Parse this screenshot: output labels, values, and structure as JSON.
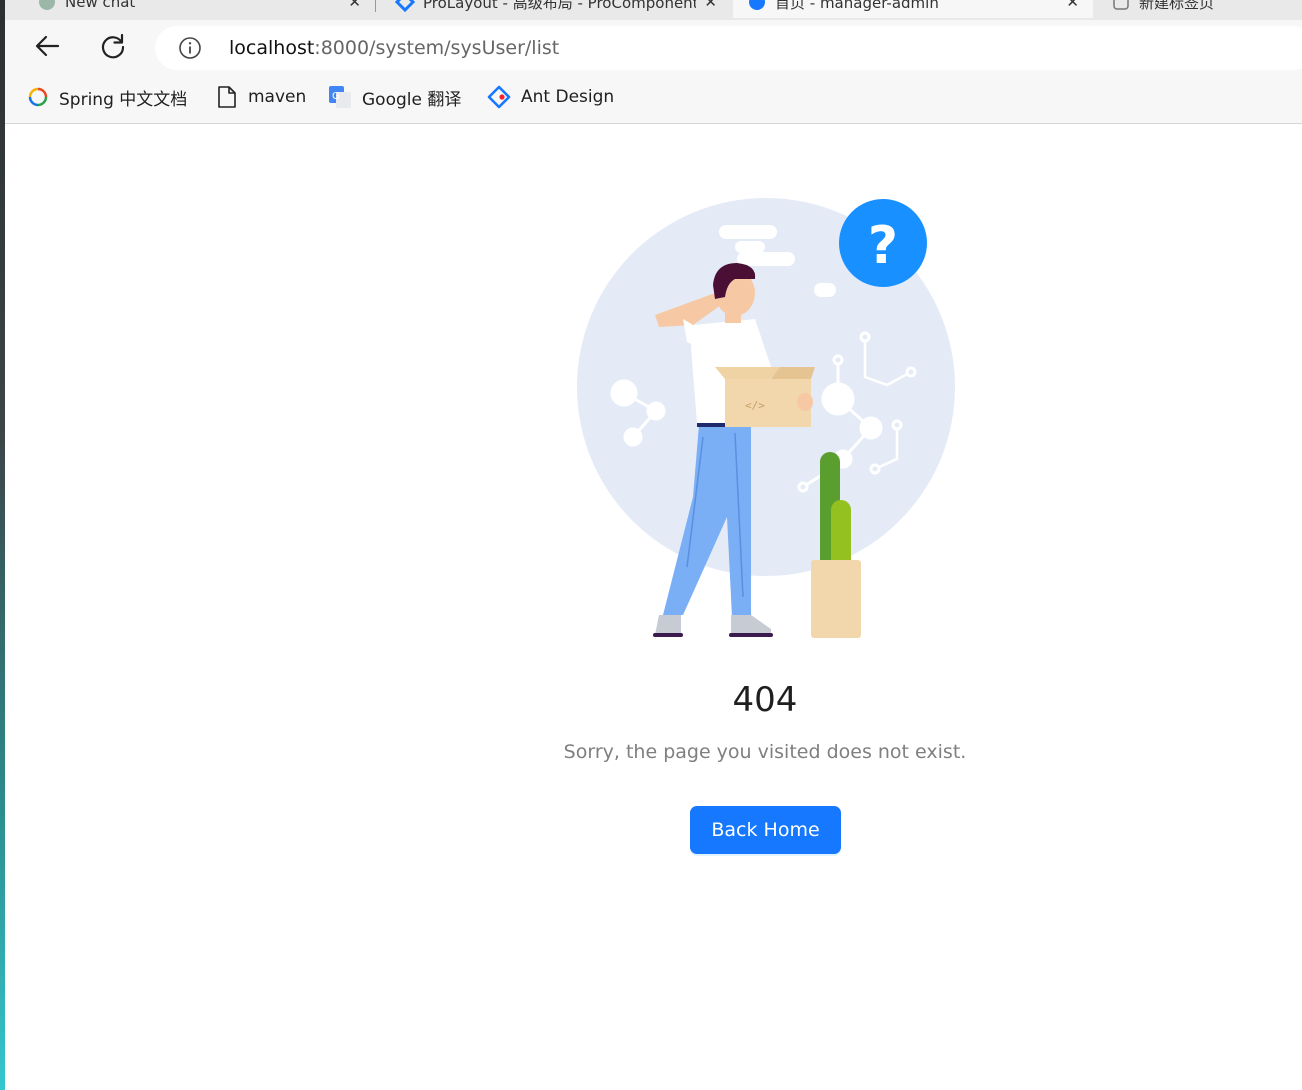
{
  "browser": {
    "tabs": [
      {
        "title": "New chat",
        "icon": "chat-app-icon",
        "active": false
      },
      {
        "title": "ProLayout - 高级布局 - ProComponents",
        "icon": "procomponents-icon",
        "active": false
      },
      {
        "title": "首页 - manager-admin",
        "icon": "site-favicon",
        "active": true
      },
      {
        "title": "新建标签页",
        "icon": "new-tab-icon",
        "active": false
      }
    ],
    "close_glyph": "✕",
    "address": {
      "host": "localhost",
      "rest": ":8000/system/sysUser/list"
    },
    "bookmarks": [
      {
        "label": "Spring 中文文档",
        "icon": "spring-icon"
      },
      {
        "label": "maven",
        "icon": "page-icon"
      },
      {
        "label": "Google 翻译",
        "icon": "google-translate-icon"
      },
      {
        "label": "Ant Design",
        "icon": "ant-design-icon"
      }
    ]
  },
  "page": {
    "status_code": "404",
    "message": "Sorry, the page you visited does not exist.",
    "button_label": "Back Home",
    "question_glyph": "?",
    "colors": {
      "primary": "#1677ff",
      "illustration_bg": "#e4ebf7",
      "question_badge": "#1890ff"
    }
  }
}
